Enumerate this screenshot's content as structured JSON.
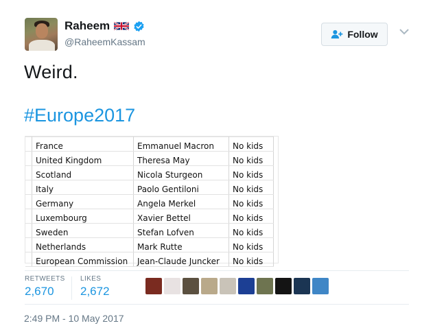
{
  "author": {
    "display_name": "Raheem",
    "handle": "@RaheemKassam",
    "flag_icon": "uk-flag-icon",
    "verified_icon": "verified-badge-icon"
  },
  "follow_button": {
    "label": "Follow",
    "icon": "add-user-icon"
  },
  "tweet": {
    "text": "Weird.",
    "hashtag": "#Europe2017"
  },
  "table": {
    "rows": [
      [
        "France",
        "Emmanuel Macron",
        "No kids"
      ],
      [
        "United Kingdom",
        "Theresa May",
        "No kids"
      ],
      [
        "Scotland",
        "Nicola Sturgeon",
        "No kids"
      ],
      [
        "Italy",
        "Paolo Gentiloni",
        "No kids"
      ],
      [
        "Germany",
        "Angela Merkel",
        "No kids"
      ],
      [
        "Luxembourg",
        "Xavier Bettel",
        "No kids"
      ],
      [
        "Sweden",
        "Stefan Lofven",
        "No kids"
      ],
      [
        "Netherlands",
        "Mark Rutte",
        "No kids"
      ],
      [
        "European Commission",
        "Jean-Claude Juncker",
        "No kids"
      ]
    ]
  },
  "stats": {
    "retweets_label": "RETWEETS",
    "retweets": "2,670",
    "likes_label": "LIKES",
    "likes": "2,672"
  },
  "likers": [
    {
      "name": "liker-avatar-1",
      "color": "#7a2b20"
    },
    {
      "name": "liker-avatar-2",
      "color": "#e8e2e2"
    },
    {
      "name": "liker-avatar-3",
      "color": "#5b5040"
    },
    {
      "name": "liker-avatar-4",
      "color": "#b9a98a"
    },
    {
      "name": "liker-avatar-5",
      "color": "#c9c3b8"
    },
    {
      "name": "liker-avatar-6",
      "color": "#1c3f94"
    },
    {
      "name": "liker-avatar-7",
      "color": "#6e7450"
    },
    {
      "name": "liker-avatar-8",
      "color": "#141414"
    },
    {
      "name": "liker-avatar-9",
      "color": "#1b3553"
    },
    {
      "name": "liker-avatar-10",
      "color": "#3f86c6"
    }
  ],
  "timestamp": "2:49 PM - 10 May 2017",
  "colors": {
    "link": "#1b95e0",
    "muted": "#657786",
    "text": "#14171a"
  }
}
